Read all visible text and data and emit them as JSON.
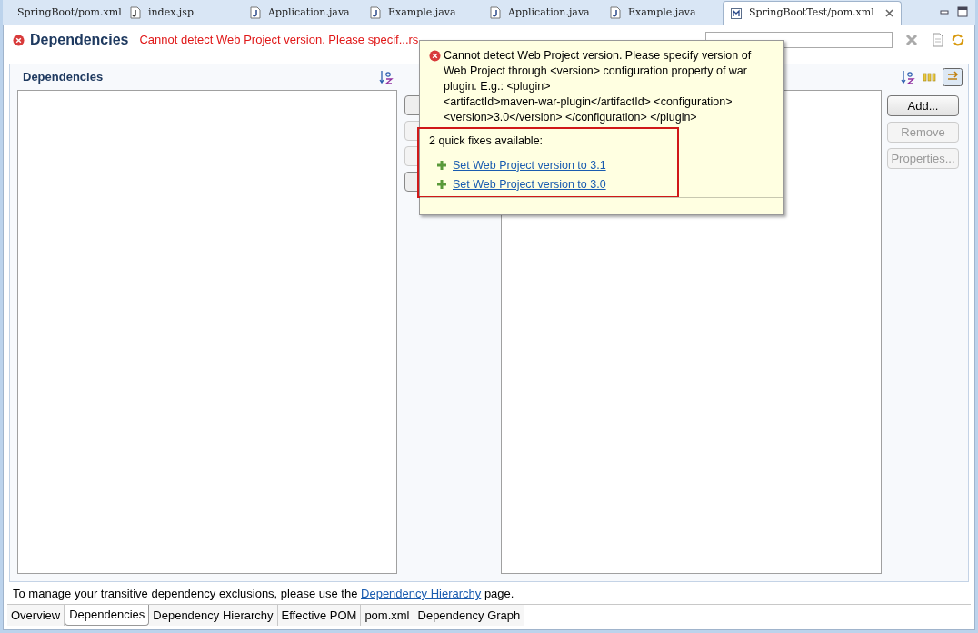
{
  "editor_tabs": [
    {
      "label": "SpringBoot/pom.xml",
      "kind": "pom",
      "selected": false
    },
    {
      "label": "index.jsp",
      "kind": "jsp",
      "selected": false
    },
    {
      "label": "Application.java",
      "kind": "java",
      "selected": false
    },
    {
      "label": "Example.java",
      "kind": "java",
      "selected": false
    },
    {
      "label": "Application.java",
      "kind": "java",
      "selected": false
    },
    {
      "label": "Example.java",
      "kind": "java",
      "selected": false
    },
    {
      "label": "SpringBootTest/pom.xml",
      "kind": "pom",
      "selected": true
    }
  ],
  "header": {
    "title": "Dependencies",
    "error": "Cannot detect Web Project version. Please specif...rs"
  },
  "left_section": {
    "title": "Dependencies"
  },
  "right_buttons": [
    {
      "label": "Add...",
      "disabled": false
    },
    {
      "label": "Remove",
      "disabled": true
    },
    {
      "label": "Properties...",
      "disabled": true
    }
  ],
  "popup": {
    "message_lines": [
      "Cannot detect Web Project version. Please specify version of",
      "Web Project through <version> configuration property of war",
      "plugin. E.g.: <plugin>",
      "<artifactId>maven-war-plugin</artifactId> <configuration>",
      "<version>3.0</version> </configuration> </plugin>"
    ],
    "fixes_title": "2 quick fixes available:",
    "fixes": [
      "Set Web Project version to 3.1",
      "Set Web Project version to 3.0"
    ]
  },
  "footer": {
    "before": "To manage your transitive dependency exclusions, please use the",
    "link": "Dependency Hierarchy",
    "after": "page."
  },
  "bottom_tabs": [
    {
      "label": "Overview",
      "selected": false
    },
    {
      "label": "Dependencies",
      "selected": true
    },
    {
      "label": "Dependency Hierarchy",
      "selected": false
    },
    {
      "label": "Effective POM",
      "selected": false
    },
    {
      "label": "pom.xml",
      "selected": false
    },
    {
      "label": "Dependency Graph",
      "selected": false
    }
  ]
}
